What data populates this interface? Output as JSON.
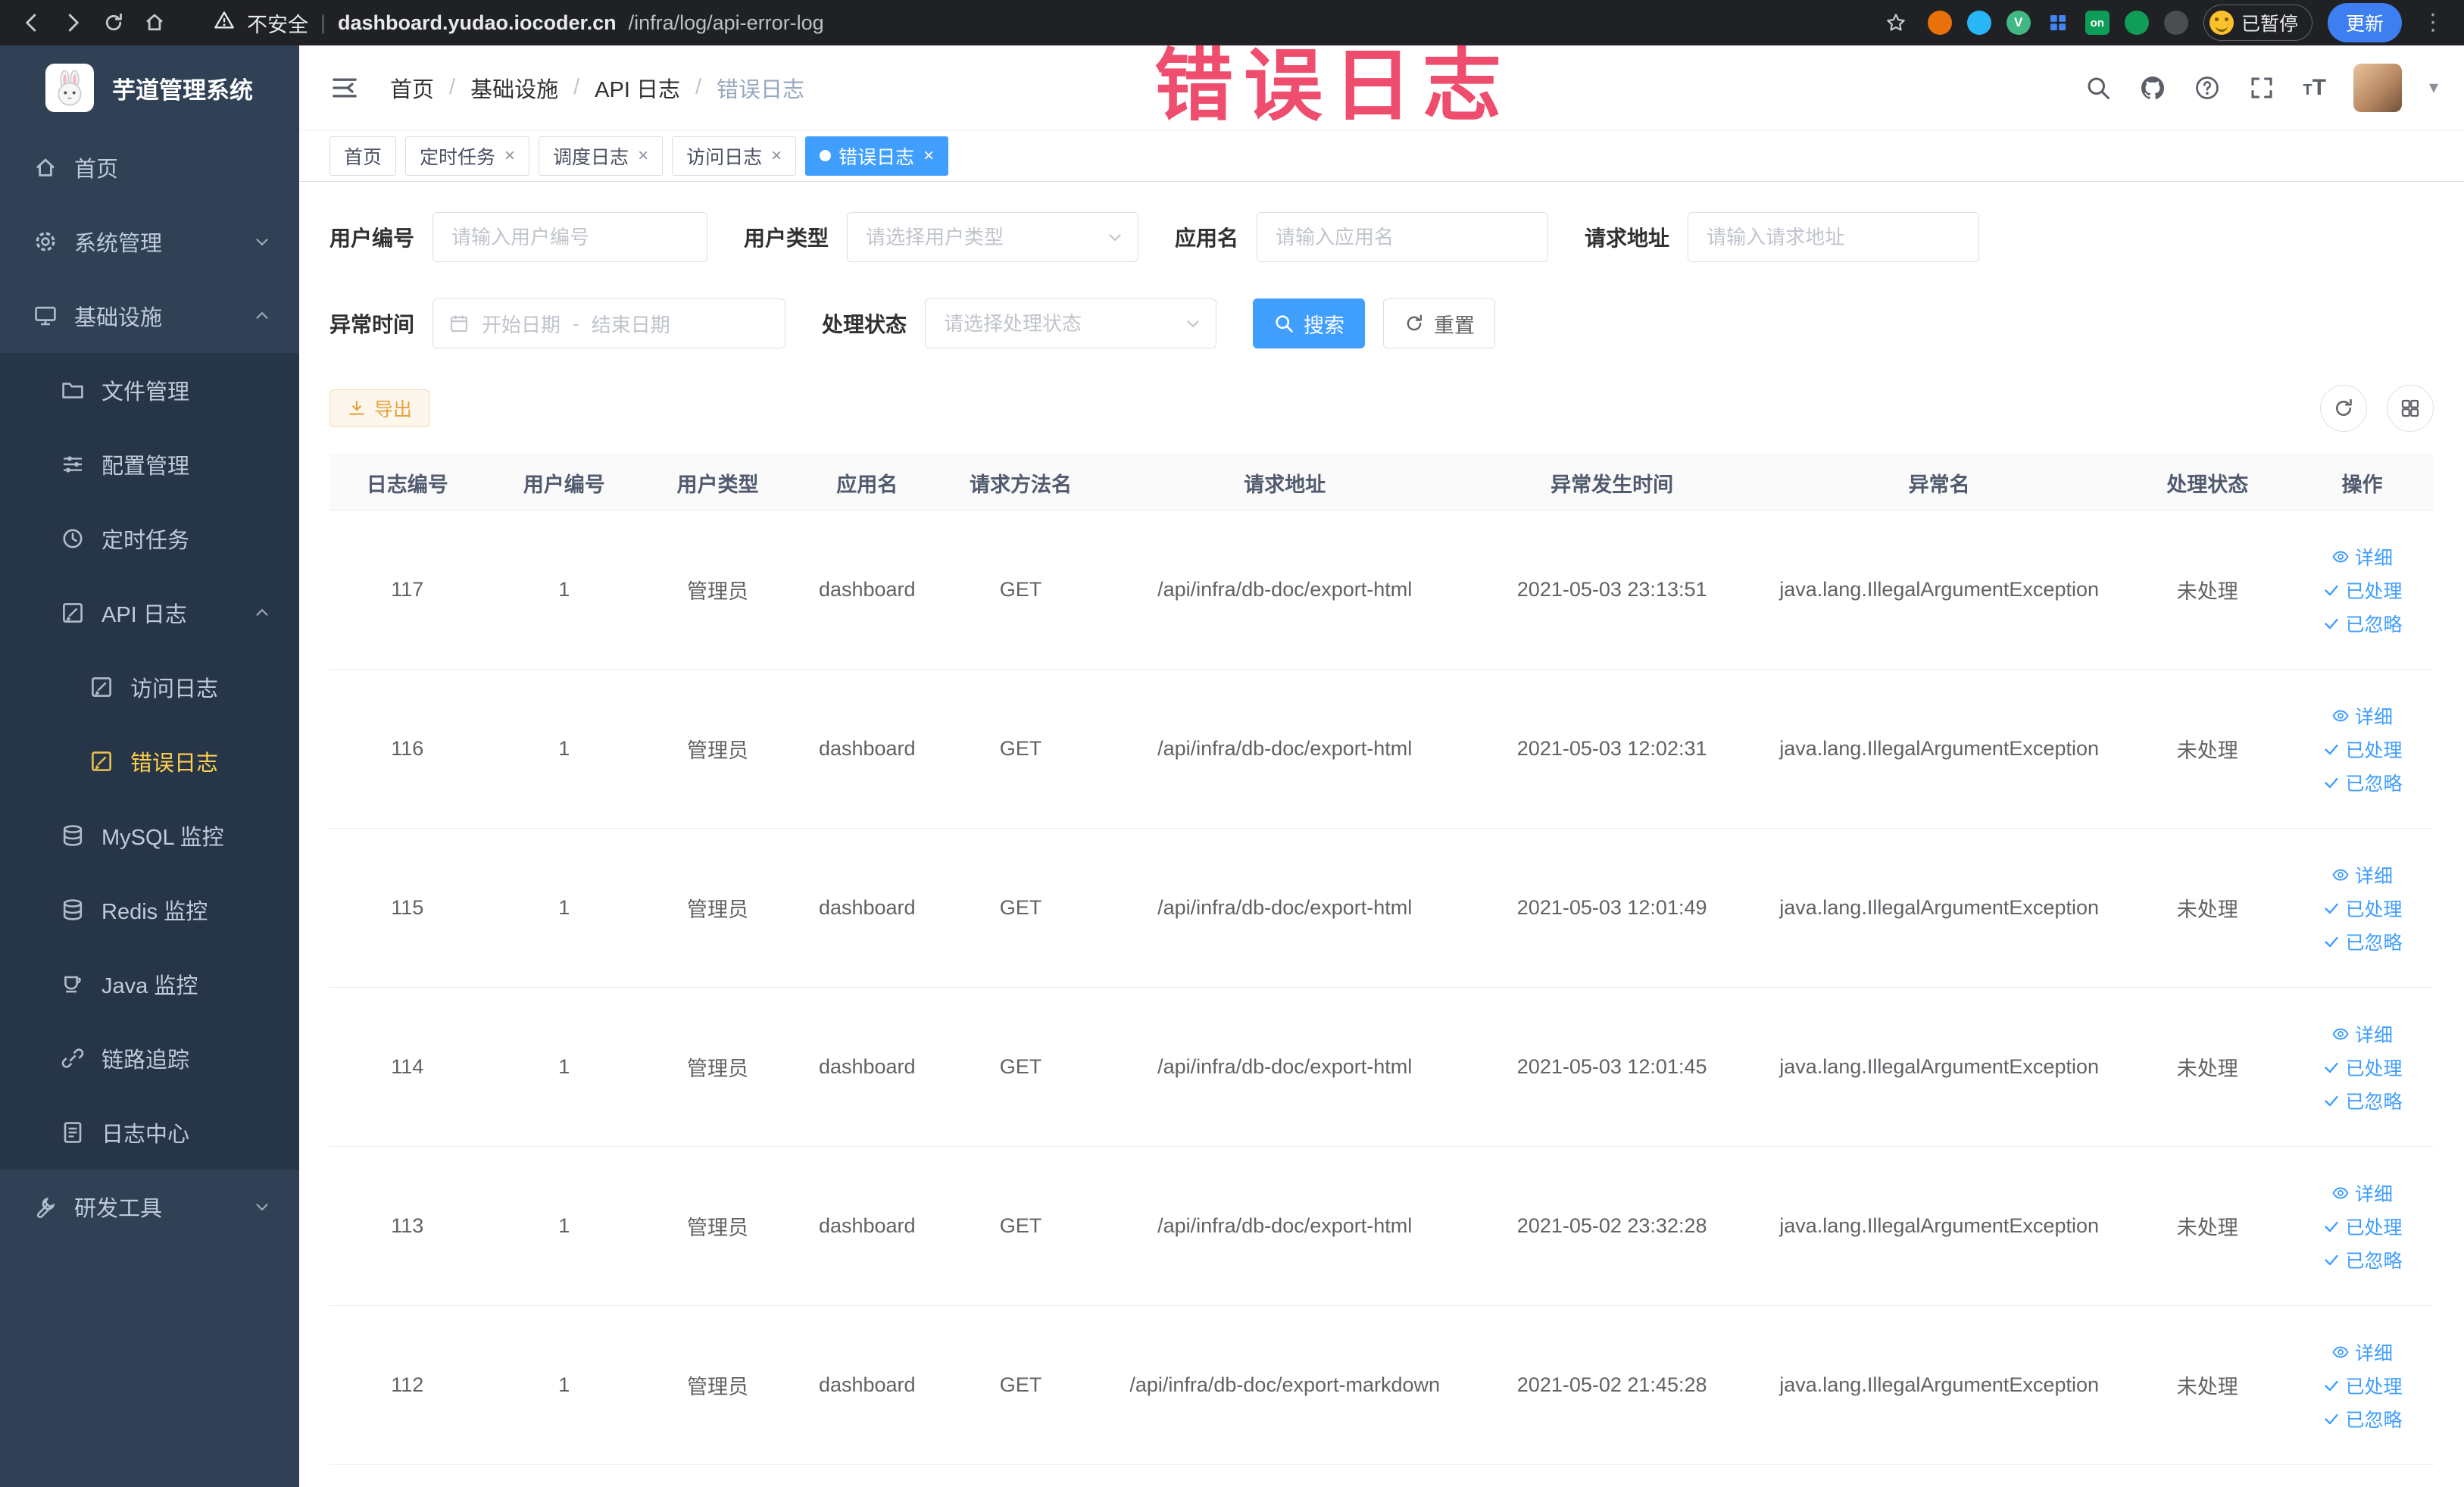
{
  "browser": {
    "security_label": "不安全",
    "url_domain": "dashboard.yudao.iocoder.cn",
    "url_path": "/infra/log/api-error-log",
    "paused_badge": "已暂停",
    "update_label": "更新",
    "vue_ext_letter": "V",
    "on_ext_label": "on"
  },
  "annotation": {
    "text": "错误日志",
    "color": "#ef4d6d"
  },
  "sidebar": {
    "logo_title": "芋道管理系统",
    "items": [
      {
        "name": "home",
        "label": "首页",
        "level": 1,
        "icon": "home"
      },
      {
        "name": "system-management",
        "label": "系统管理",
        "level": 1,
        "icon": "gear",
        "chevron": "down"
      },
      {
        "name": "infrastructure",
        "label": "基础设施",
        "level": 1,
        "icon": "monitor",
        "chevron": "up"
      },
      {
        "name": "file-management",
        "label": "文件管理",
        "level": 2,
        "icon": "folder",
        "sub": true
      },
      {
        "name": "config-management",
        "label": "配置管理",
        "level": 2,
        "icon": "config",
        "sub": true
      },
      {
        "name": "scheduled-tasks",
        "label": "定时任务",
        "level": 2,
        "icon": "clock",
        "sub": true
      },
      {
        "name": "api-logs",
        "label": "API 日志",
        "level": 2,
        "icon": "edit",
        "chevron": "up",
        "sub": true
      },
      {
        "name": "access-log",
        "label": "访问日志",
        "level": 3,
        "icon": "edit",
        "sub": true
      },
      {
        "name": "error-log",
        "label": "错误日志",
        "level": 3,
        "icon": "edit",
        "sub": true,
        "active": true
      },
      {
        "name": "mysql-monitor",
        "label": "MySQL 监控",
        "level": 2,
        "icon": "db",
        "sub": true
      },
      {
        "name": "redis-monitor",
        "label": "Redis 监控",
        "level": 2,
        "icon": "db",
        "sub": true
      },
      {
        "name": "java-monitor",
        "label": "Java 监控",
        "level": 2,
        "icon": "cup",
        "sub": true
      },
      {
        "name": "tracing",
        "label": "链路追踪",
        "level": 2,
        "icon": "link",
        "sub": true
      },
      {
        "name": "log-center",
        "label": "日志中心",
        "level": 2,
        "icon": "doc",
        "sub": true
      },
      {
        "name": "dev-tools",
        "label": "研发工具",
        "level": 1,
        "icon": "tool",
        "chevron": "down"
      }
    ]
  },
  "breadcrumb": [
    "首页",
    "基础设施",
    "API 日志",
    "错误日志"
  ],
  "tabs": [
    {
      "name": "home",
      "label": "首页",
      "closable": false,
      "active": false
    },
    {
      "name": "scheduled-tasks",
      "label": "定时任务",
      "closable": true,
      "active": false
    },
    {
      "name": "schedule-log",
      "label": "调度日志",
      "closable": true,
      "active": false
    },
    {
      "name": "access-log",
      "label": "访问日志",
      "closable": true,
      "active": false
    },
    {
      "name": "error-log",
      "label": "错误日志",
      "closable": true,
      "active": true
    }
  ],
  "filters": {
    "user_id_label": "用户编号",
    "user_id_placeholder": "请输入用户编号",
    "user_type_label": "用户类型",
    "user_type_placeholder": "请选择用户类型",
    "app_name_label": "应用名",
    "app_name_placeholder": "请输入应用名",
    "request_url_label": "请求地址",
    "request_url_placeholder": "请输入请求地址",
    "exception_time_label": "异常时间",
    "date_start_placeholder": "开始日期",
    "date_separator": "-",
    "date_end_placeholder": "结束日期",
    "process_status_label": "处理状态",
    "process_status_placeholder": "请选择处理状态",
    "search_label": "搜索",
    "reset_label": "重置"
  },
  "toolbar": {
    "export_label": "导出"
  },
  "table": {
    "columns": [
      "日志编号",
      "用户编号",
      "用户类型",
      "应用名",
      "请求方法名",
      "请求地址",
      "异常发生时间",
      "异常名",
      "处理状态",
      "操作"
    ],
    "col_widths": [
      "7.4%",
      "7.5%",
      "7.1%",
      "7.1%",
      "7.5%",
      "17.6%",
      "13.5%",
      "17.6%",
      "7.9%",
      "6.8%"
    ],
    "action_labels": {
      "detail": "详细",
      "process": "已处理",
      "ignore": "已忽略"
    },
    "rows": [
      {
        "id": "117",
        "user_id": "1",
        "user_type": "管理员",
        "app": "dashboard",
        "method": "GET",
        "url": "/api/infra/db-doc/export-html",
        "time": "2021-05-03 23:13:51",
        "exception": "java.lang.IllegalArgumentException",
        "status": "未处理"
      },
      {
        "id": "116",
        "user_id": "1",
        "user_type": "管理员",
        "app": "dashboard",
        "method": "GET",
        "url": "/api/infra/db-doc/export-html",
        "time": "2021-05-03 12:02:31",
        "exception": "java.lang.IllegalArgumentException",
        "status": "未处理"
      },
      {
        "id": "115",
        "user_id": "1",
        "user_type": "管理员",
        "app": "dashboard",
        "method": "GET",
        "url": "/api/infra/db-doc/export-html",
        "time": "2021-05-03 12:01:49",
        "exception": "java.lang.IllegalArgumentException",
        "status": "未处理"
      },
      {
        "id": "114",
        "user_id": "1",
        "user_type": "管理员",
        "app": "dashboard",
        "method": "GET",
        "url": "/api/infra/db-doc/export-html",
        "time": "2021-05-03 12:01:45",
        "exception": "java.lang.IllegalArgumentException",
        "status": "未处理"
      },
      {
        "id": "113",
        "user_id": "1",
        "user_type": "管理员",
        "app": "dashboard",
        "method": "GET",
        "url": "/api/infra/db-doc/export-html",
        "time": "2021-05-02 23:32:28",
        "exception": "java.lang.IllegalArgumentException",
        "status": "未处理"
      },
      {
        "id": "112",
        "user_id": "1",
        "user_type": "管理员",
        "app": "dashboard",
        "method": "GET",
        "url": "/api/infra/db-doc/export-markdown",
        "time": "2021-05-02 21:45:28",
        "exception": "java.lang.IllegalArgumentException",
        "status": "未处理"
      }
    ]
  }
}
